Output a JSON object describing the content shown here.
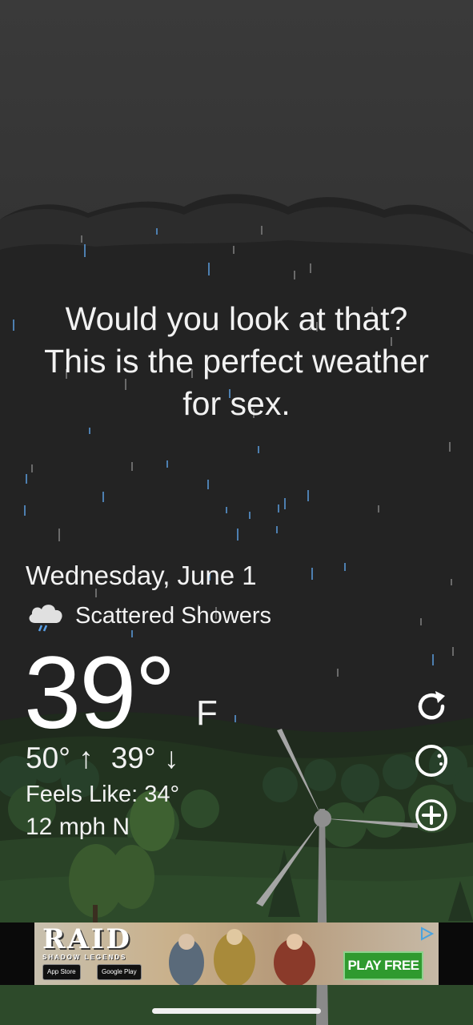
{
  "message": "Would you look at that?\nThis is the perfect weather\nfor sex.",
  "date": "Wednesday, June 1",
  "condition": {
    "text": "Scattered Showers",
    "icon": "cloud-rain-icon"
  },
  "temperature": {
    "value": "39°",
    "unit": "F"
  },
  "high_low": {
    "high": "50° ↑",
    "low": "39° ↓"
  },
  "feels_like": "Feels Like: 34°",
  "wind": "12 mph N",
  "side_buttons": [
    "refresh-icon",
    "moon-phase-icon",
    "add-icon"
  ],
  "ad": {
    "logo": "RAID",
    "subtitle": "SHADOW LEGENDS",
    "app_store": "App Store",
    "google_play": "Google Play",
    "cta": "PLAY FREE"
  },
  "colors": {
    "sky": "#232323",
    "text": "#ffffff",
    "cta": "#2f9a2f"
  }
}
